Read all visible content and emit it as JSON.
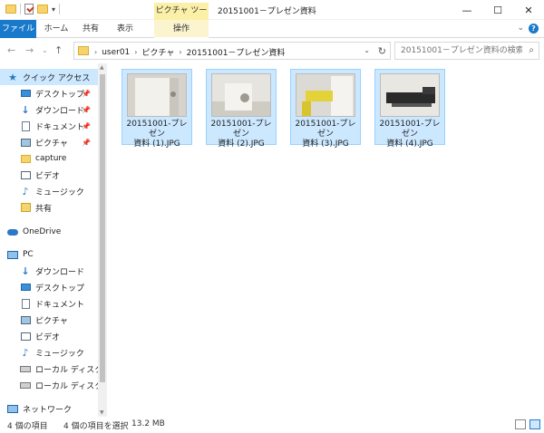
{
  "window": {
    "title": "20151001－プレゼン資料",
    "context_tab_header": "ピクチャ ツール"
  },
  "controls": {
    "minimize": "—",
    "maximize": "☐",
    "close": "✕"
  },
  "ribbon": {
    "tabs": [
      "ファイル",
      "ホーム",
      "共有",
      "表示",
      "操作"
    ],
    "help": "?",
    "expand": "⌄"
  },
  "address": {
    "breadcrumbs": [
      "user01",
      "ピクチャ",
      "20151001－プレゼン資料"
    ],
    "search_placeholder": "20151001－プレゼン資料の検索"
  },
  "nav": {
    "quick_access": "クイック アクセス",
    "quick_items": [
      "デスクトップ",
      "ダウンロード",
      "ドキュメント",
      "ピクチャ",
      "capture",
      "ビデオ",
      "ミュージック",
      "共有"
    ],
    "onedrive": "OneDrive",
    "pc": "PC",
    "pc_items": [
      "ダウンロード",
      "デスクトップ",
      "ドキュメント",
      "ピクチャ",
      "ビデオ",
      "ミュージック",
      "ローカル ディスク (C",
      "ローカル ディスク (D"
    ],
    "network": "ネットワーク"
  },
  "files": [
    {
      "name_line1": "20151001-プレゼン",
      "name_line2": "資料 (1).JPG",
      "thumb": "camera-photo-1"
    },
    {
      "name_line1": "20151001-プレゼン",
      "name_line2": "資料 (2).JPG",
      "thumb": "camera-photo-2"
    },
    {
      "name_line1": "20151001-プレゼン",
      "name_line2": "資料 (3).JPG",
      "thumb": "camera-photo-3"
    },
    {
      "name_line1": "20151001-プレゼン",
      "name_line2": "資料 (4).JPG",
      "thumb": "camera-photo-4"
    }
  ],
  "status": {
    "item_count": "4 個の項目",
    "selected": "4 個の項目を選択",
    "size": "13.2 MB"
  },
  "colors": {
    "accent": "#1979ca",
    "selection": "#cce8ff",
    "context_tab": "#fbf0a8"
  }
}
